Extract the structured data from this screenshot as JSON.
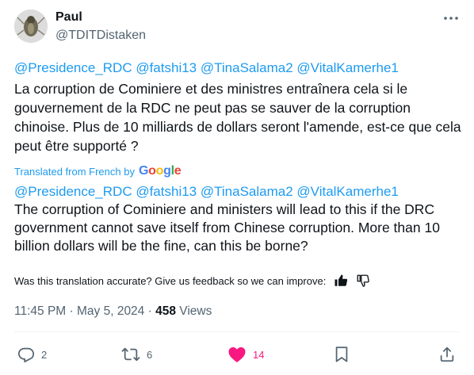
{
  "author": {
    "name": "Paul",
    "handle": "@TDITDistaken"
  },
  "original": {
    "mentions": [
      "@Presidence_RDC",
      "@fatshi13",
      "@TinaSalama2",
      "@VitalKamerhe1"
    ],
    "text": "La corruption de Cominiere et des ministres entraînera cela si le gouvernement de la RDC ne peut pas se sauver de la corruption chinoise. Plus de 10 milliards de dollars seront l'amende, est-ce que cela peut être supporté ?"
  },
  "translation": {
    "label": "Translated from French by",
    "provider": "Google",
    "mentions": [
      "@Presidence_RDC",
      "@fatshi13",
      "@TinaSalama2",
      "@VitalKamerhe1"
    ],
    "text": "The corruption of Cominiere and ministers will lead to this if the DRC government cannot save itself from Chinese corruption. More than 10 billion dollars will be the fine, can this be borne?",
    "feedback_prompt": "Was this translation accurate? Give us feedback so we can improve:"
  },
  "meta": {
    "time": "11:45 PM",
    "separator": "·",
    "date": "May 5, 2024",
    "views_count": "458",
    "views_label": "Views"
  },
  "actions": {
    "replies": "2",
    "reposts": "6",
    "likes": "14",
    "liked": true
  },
  "icons": [
    "more-icon",
    "thumbs-up-icon",
    "thumbs-down-icon",
    "reply-icon",
    "retweet-icon",
    "heart-icon",
    "bookmark-icon",
    "share-icon"
  ],
  "colors": {
    "link": "#1d9bf0",
    "text": "#0f1419",
    "secondary": "#536471",
    "like": "#f91880",
    "divider": "#eff3f4"
  }
}
